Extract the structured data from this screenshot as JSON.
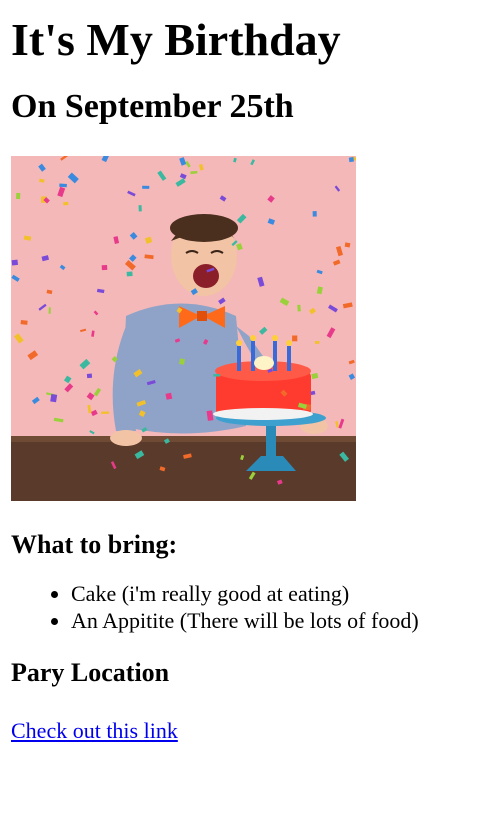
{
  "header": {
    "title": "It's My Birthday",
    "subtitle": "On September 25th"
  },
  "photo": {
    "icon": "birthday-boy-photo",
    "colors": {
      "wall": "#f4b8b8",
      "table": "#5a3a2a",
      "shirt": "#8fa3c8",
      "cake": "#ff3b2f",
      "bowtie": "#ff6a1a",
      "stand": "#2a8ab8"
    }
  },
  "bring": {
    "heading": "What to bring:",
    "items": [
      {
        "label": "Cake (i'm really good at eating)"
      },
      {
        "label": "An Appitite (There will be lots of food)"
      }
    ]
  },
  "location": {
    "heading": "Pary Location",
    "link_label": "Check out this link"
  }
}
